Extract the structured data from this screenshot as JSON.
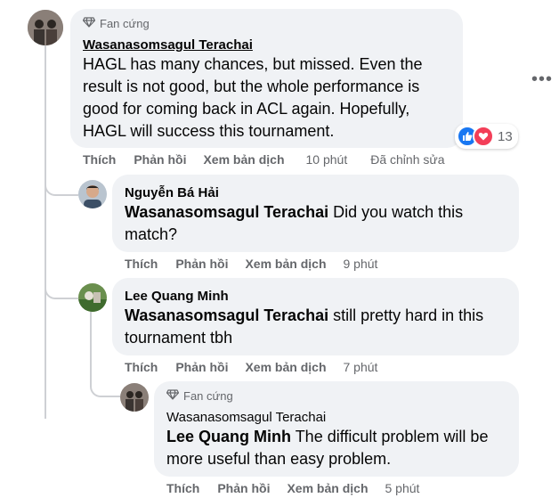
{
  "comment1": {
    "badge": "Fan cứng",
    "author": "Wasanasomsagul Terachai",
    "text": "HAGL has many chances, but missed. Even the result is not good, but the whole performance is good for coming back in ACL again. Hopefully, HAGL will success this tournament.",
    "reaction_count": "13",
    "actions": {
      "like": "Thích",
      "reply": "Phản hồi",
      "translate": "Xem bản dịch",
      "time": "10 phút",
      "edited": "Đã chỉnh sửa"
    }
  },
  "reply1": {
    "author": "Nguyễn Bá Hải",
    "mention": "Wasanasomsagul Terachai",
    "text": " Did you watch this match?",
    "actions": {
      "like": "Thích",
      "reply": "Phản hồi",
      "translate": "Xem bản dịch",
      "time": "9 phút"
    }
  },
  "reply2": {
    "author": "Lee Quang Minh",
    "mention": "Wasanasomsagul Terachai",
    "text": " still pretty hard in this tournament tbh",
    "actions": {
      "like": "Thích",
      "reply": "Phản hồi",
      "translate": "Xem bản dịch",
      "time": "7 phút"
    }
  },
  "reply3": {
    "badge": "Fan cứng",
    "author": "Wasanasomsagul Terachai",
    "mention": "Lee Quang Minh",
    "text": " The difficult problem will be more useful than easy problem.",
    "actions": {
      "like": "Thích",
      "reply": "Phản hồi",
      "translate": "Xem bản dịch",
      "time": "5 phút"
    }
  },
  "icons": {
    "badge": "diamond-icon",
    "more": "more-options-icon",
    "like": "like-reaction-icon",
    "love": "love-reaction-icon"
  },
  "colors": {
    "like": "#1877f2",
    "love": "#f33e58",
    "bubble": "#f0f2f5",
    "meta": "#65676b"
  }
}
